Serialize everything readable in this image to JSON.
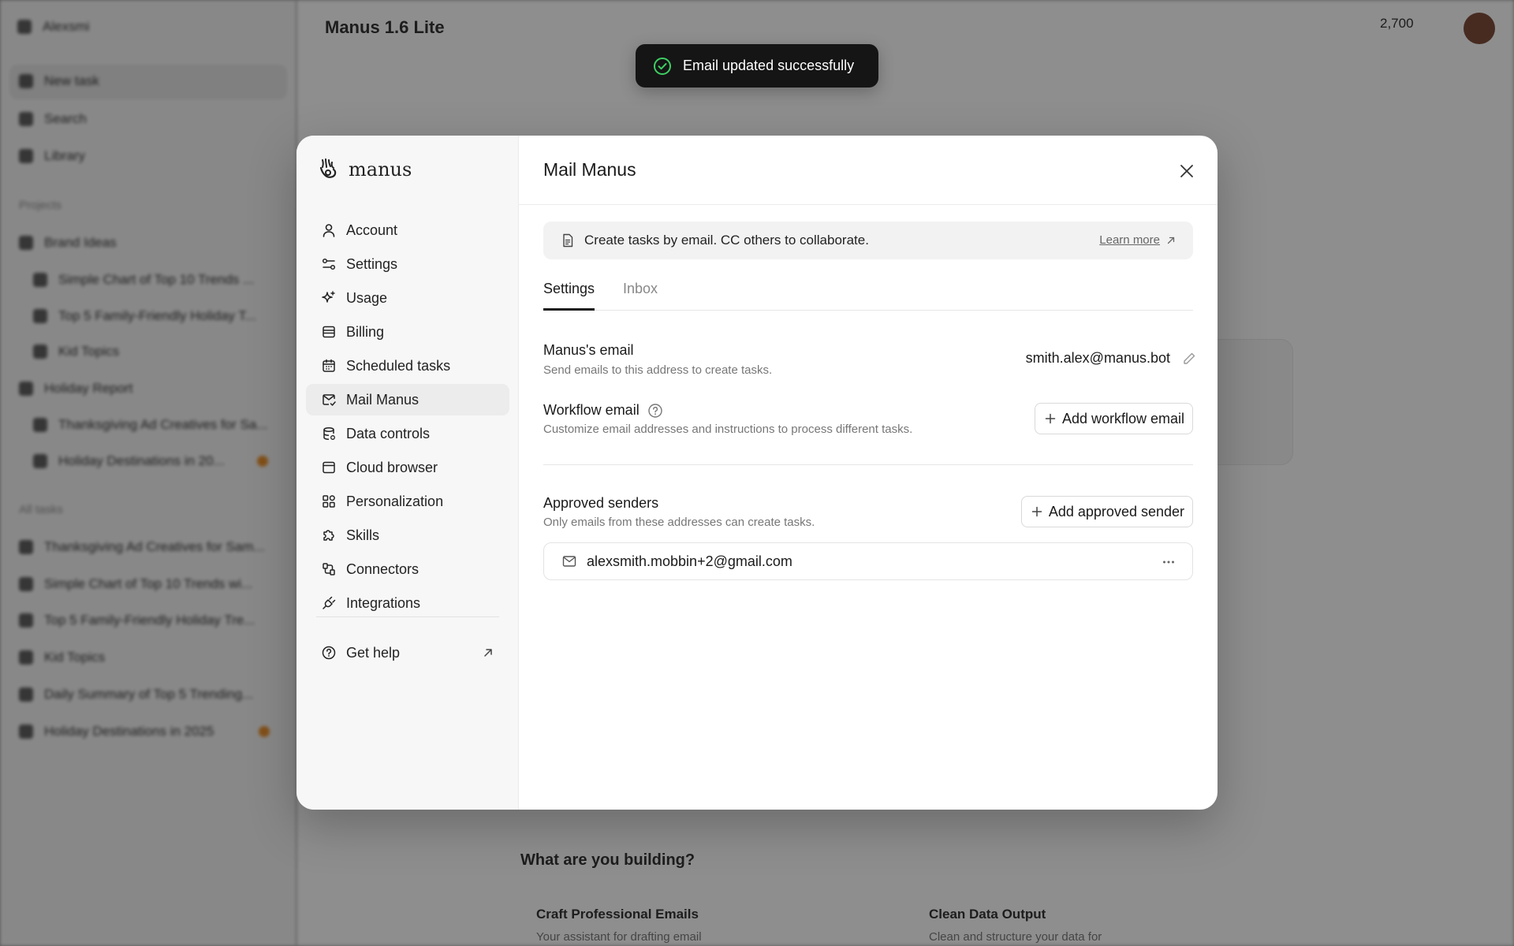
{
  "background": {
    "workspace_name": "Alexsmi",
    "nav": [
      "New task",
      "Search",
      "Library"
    ],
    "projects_heading": "Projects",
    "projects": [
      "Brand Ideas",
      "Simple Chart of Top 10 Trends ...",
      "Top 5 Family-Friendly Holiday T...",
      "Kid Topics",
      "Holiday Report",
      "Thanksgiving Ad Creatives for Sa...",
      "Holiday Destinations in 20..."
    ],
    "tasks_heading": "All tasks",
    "tasks": [
      "Thanksgiving Ad Creatives for Sam...",
      "Simple Chart of Top 10 Trends wi...",
      "Top 5 Family-Friendly Holiday Tre...",
      "Kid Topics",
      "Daily Summary of Top 5 Trending...",
      "Holiday Destinations in 2025"
    ],
    "model_title": "Manus 1.6 Lite",
    "credits": "2,700",
    "building_heading": "What are you building?",
    "cards": [
      {
        "title": "Craft Professional Emails",
        "subtitle": "Your assistant for drafting email"
      },
      {
        "title": "Clean Data Output",
        "subtitle": "Clean and structure your data for"
      }
    ]
  },
  "toast": {
    "message": "Email updated successfully",
    "icon": "check-circle-icon",
    "accent": "#3ecf63"
  },
  "modal": {
    "brand": "manus",
    "nav": {
      "items": [
        {
          "label": "Account",
          "icon": "user-icon"
        },
        {
          "label": "Settings",
          "icon": "sliders-icon"
        },
        {
          "label": "Usage",
          "icon": "sparkle-icon"
        },
        {
          "label": "Billing",
          "icon": "card-icon"
        },
        {
          "label": "Scheduled tasks",
          "icon": "calendar-icon"
        },
        {
          "label": "Mail Manus",
          "icon": "mail-check-icon"
        },
        {
          "label": "Data controls",
          "icon": "database-icon"
        },
        {
          "label": "Cloud browser",
          "icon": "browser-icon"
        },
        {
          "label": "Personalization",
          "icon": "grid-icon"
        },
        {
          "label": "Skills",
          "icon": "puzzle-icon"
        },
        {
          "label": "Connectors",
          "icon": "connector-icon"
        },
        {
          "label": "Integrations",
          "icon": "plug-icon"
        }
      ],
      "active": "Mail Manus",
      "help": "Get help"
    },
    "title": "Mail Manus",
    "banner": {
      "text": "Create tasks by email. CC others to collaborate.",
      "link": "Learn more"
    },
    "tabs": [
      "Settings",
      "Inbox"
    ],
    "active_tab": "Settings",
    "manus_email": {
      "label": "Manus's email",
      "description": "Send emails to this address to create tasks.",
      "value": "smith.alex@manus.bot"
    },
    "workflow_email": {
      "label": "Workflow email",
      "description": "Customize email addresses and instructions to process different tasks.",
      "button": "Add workflow email"
    },
    "approved_senders": {
      "label": "Approved senders",
      "description": "Only emails from these addresses can create tasks.",
      "button": "Add approved sender",
      "senders": [
        "alexsmith.mobbin+2@gmail.com"
      ]
    }
  }
}
